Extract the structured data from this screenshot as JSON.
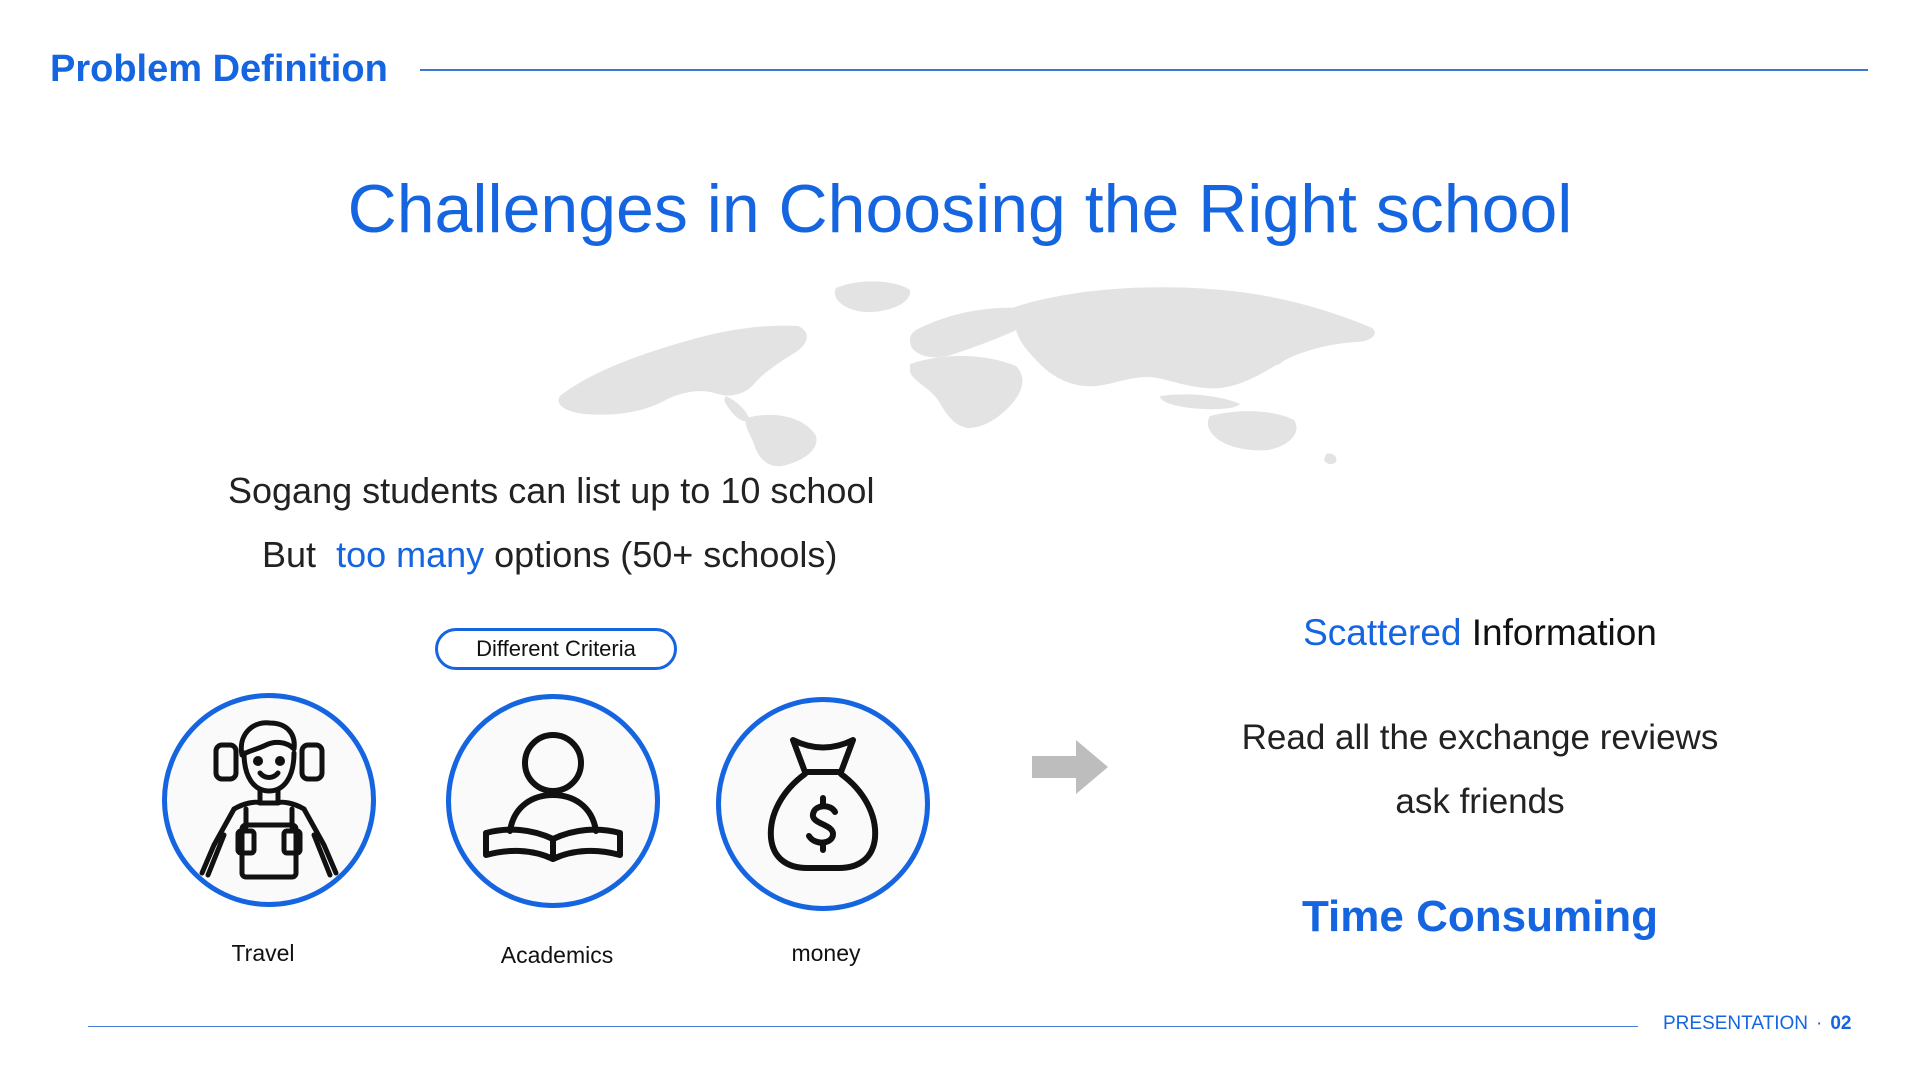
{
  "header": {
    "title": "Problem Definition"
  },
  "slide": {
    "title": "Challenges in Choosing the Right school"
  },
  "intro": {
    "line1": "Sogang students can list up to 10 school",
    "line2_prefix": "But",
    "line2_accent": "too many",
    "line2_suffix": "options (50+ schools)"
  },
  "criteria": {
    "pill_label": "Different Criteria",
    "items": [
      {
        "label": "Travel",
        "icon": "traveler-backpack-icon"
      },
      {
        "label": "Academics",
        "icon": "person-reading-book-icon"
      },
      {
        "label": "money",
        "icon": "money-bag-dollar-icon"
      }
    ]
  },
  "right": {
    "scattered_accent": "Scattered",
    "scattered_rest": "Information",
    "reviews_line1": "Read all the exchange reviews",
    "reviews_line2": "ask friends",
    "conclusion": "Time Consuming"
  },
  "footer": {
    "label": "PRESENTATION",
    "separator": "·",
    "page": "02"
  },
  "colors": {
    "accent": "#1565e0",
    "map": "#e3e3e3",
    "arrow": "#bdbdbd"
  }
}
